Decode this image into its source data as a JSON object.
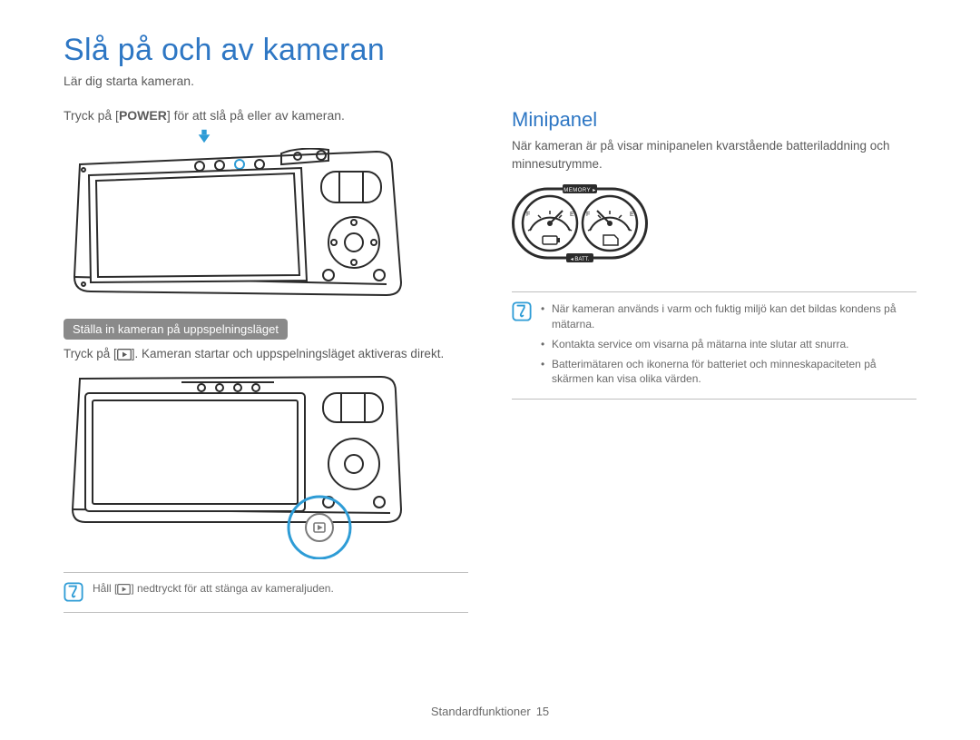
{
  "title": "Slå på och av kameran",
  "subtitle": "Lär dig starta kameran.",
  "left": {
    "pressPrefix": "Tryck på [",
    "power": "POWER",
    "pressSuffix": "] för att slå på eller av kameran.",
    "playbackSectionLabel": "Ställa in kameran på uppspelningsläget",
    "playbackTextPrefix": "Tryck på [",
    "playbackTextSuffix": "]. Kameran startar och uppspelningsläget aktiveras direkt.",
    "bottomNotePrefix": "Håll [",
    "bottomNoteSuffix": "] nedtryckt för att stänga av kameraljuden."
  },
  "right": {
    "heading": "Minipanel",
    "intro": "När kameran är på visar minipanelen kvarstående batteriladdning och minnesutrymme.",
    "gaugeLabels": {
      "memory": "MEMORY",
      "batt": "BATT.",
      "f": "F",
      "e": "E"
    },
    "notes": [
      "När kameran används i varm och fuktig miljö kan det bildas kondens på mätarna.",
      "Kontakta service om visarna på mätarna inte slutar att snurra.",
      "Batterimätaren och ikonerna för batteriet och minneskapaciteten på skärmen kan visa olika värden."
    ]
  },
  "footer": {
    "section": "Standardfunktioner",
    "page": "15"
  },
  "icons": {
    "arrowDown": "arrow-down-icon",
    "play": "play-icon",
    "note": "note-icon"
  }
}
